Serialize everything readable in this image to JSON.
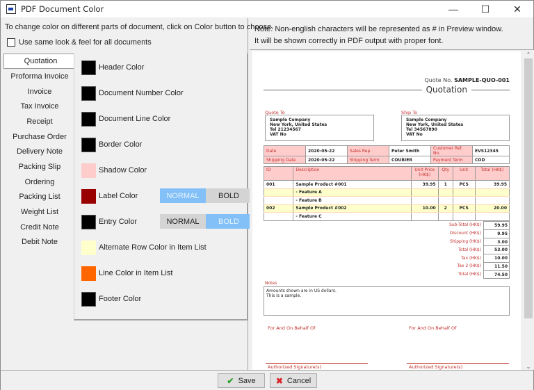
{
  "window": {
    "title": "PDF Document Color",
    "icon": "pdf-doc-icon",
    "controls": {
      "minimize": "—",
      "maximize": "☐",
      "close": "✕"
    }
  },
  "left": {
    "instruction": "To change color on different parts of document, click on Color button to choose.",
    "same_look": {
      "label": "Use same look & feel for all documents",
      "checked": false
    },
    "documents": [
      {
        "label": "Quotation",
        "selected": true
      },
      {
        "label": "Proforma Invoice"
      },
      {
        "label": "Invoice"
      },
      {
        "label": "Tax Invoice"
      },
      {
        "label": "Receipt"
      },
      {
        "label": "Purchase Order"
      },
      {
        "label": "Delivery Note"
      },
      {
        "label": "Packing Slip"
      },
      {
        "label": "Ordering"
      },
      {
        "label": "Packing List"
      },
      {
        "label": "Weight List"
      },
      {
        "label": "Credit Note"
      },
      {
        "label": "Debit Note"
      }
    ],
    "colors": [
      {
        "label": "Header Color",
        "color": "#000000"
      },
      {
        "label": "Document Number Color",
        "color": "#000000"
      },
      {
        "label": "Document Line Color",
        "color": "#000000"
      },
      {
        "label": "Border Color",
        "color": "#000000"
      },
      {
        "label": "Shadow Color",
        "color": "#ffcccc"
      },
      {
        "label": "Label Color",
        "color": "#990000",
        "style_toggle": {
          "options": [
            "NORMAL",
            "BOLD"
          ],
          "selected": "NORMAL"
        }
      },
      {
        "label": "Entry Color",
        "color": "#000000",
        "style_toggle": {
          "options": [
            "NORMAL",
            "BOLD"
          ],
          "selected": "BOLD"
        }
      },
      {
        "label": "Alternate Row Color in Item List",
        "color": "#ffffcc"
      },
      {
        "label": "Line Color in Item List",
        "color": "#ff6600"
      },
      {
        "label": "Footer Color",
        "color": "#000000"
      }
    ]
  },
  "right": {
    "note_line1": "Note: Non-english characters will be represented as # in Preview window.",
    "note_line2": "It will be shown correctly in PDF output with proper font."
  },
  "preview": {
    "quote_no_label": "Quote No.",
    "quote_no": "SAMPLE-QUO-001",
    "title": "Quotation",
    "quote_to": {
      "label": "Quote To",
      "lines": [
        "Sample Company",
        "New York, United States",
        "Tel 21234567",
        "VAT No"
      ]
    },
    "ship_to": {
      "label": "Ship To",
      "lines": [
        "Sample Company",
        "New York, United States",
        "Tel 34567890",
        "VAT No"
      ]
    },
    "info": [
      [
        {
          "l": "Date"
        },
        {
          "v": "2020-05-22"
        },
        {
          "l": "Sales Rep."
        },
        {
          "v": "Peter Smith"
        },
        {
          "l": "Customer Ref. No."
        },
        {
          "v": "EVS12345"
        }
      ],
      [
        {
          "l": "Shipping Date"
        },
        {
          "v": "2020-05-22"
        },
        {
          "l": "Shipping Term"
        },
        {
          "v": "COURIER"
        },
        {
          "l": "Payment Term"
        },
        {
          "v": "COD"
        }
      ]
    ],
    "item_headers": [
      "ID",
      "Description",
      "Unit Price (HK$)",
      "Qty",
      "Unit",
      "Total (HK$)"
    ],
    "items": [
      {
        "id": "001",
        "desc": "Sample Product #001",
        "price": "39.95",
        "qty": "1",
        "unit": "PCS",
        "total": "39.95"
      },
      {
        "id": "",
        "desc": "- Feature A",
        "price": "",
        "qty": "",
        "unit": "",
        "total": ""
      },
      {
        "id": "",
        "desc": "- Feature B",
        "price": "",
        "qty": "",
        "unit": "",
        "total": ""
      },
      {
        "id": "002",
        "desc": "Sample Product #002",
        "price": "10.00",
        "qty": "2",
        "unit": "PCS",
        "total": "20.00"
      },
      {
        "id": "",
        "desc": "- Feature C",
        "price": "",
        "qty": "",
        "unit": "",
        "total": ""
      }
    ],
    "totals": [
      {
        "label": "Sub-Total (HK$)",
        "value": "59.95"
      },
      {
        "label": "Discount (HK$)",
        "value": "9.95"
      },
      {
        "label": "Shipping (HK$)",
        "value": "3.00"
      },
      {
        "label": "Total (HK$)",
        "value": "53.00"
      },
      {
        "label": "Tax (HK$)",
        "value": "10.00"
      },
      {
        "label": "Tax 2 (HK$)",
        "value": "11.50"
      },
      {
        "label": "Total (HK$)",
        "value": "74.50"
      }
    ],
    "notes_label": "Notes",
    "notes_lines": [
      "Amounts shown are in US dollars.",
      "This is a sample."
    ],
    "behalf_label": "For And On Behalf Of",
    "signature_label": "Authorized Signature(s)"
  },
  "footer": {
    "save_label": "Save",
    "cancel_label": "Cancel"
  }
}
